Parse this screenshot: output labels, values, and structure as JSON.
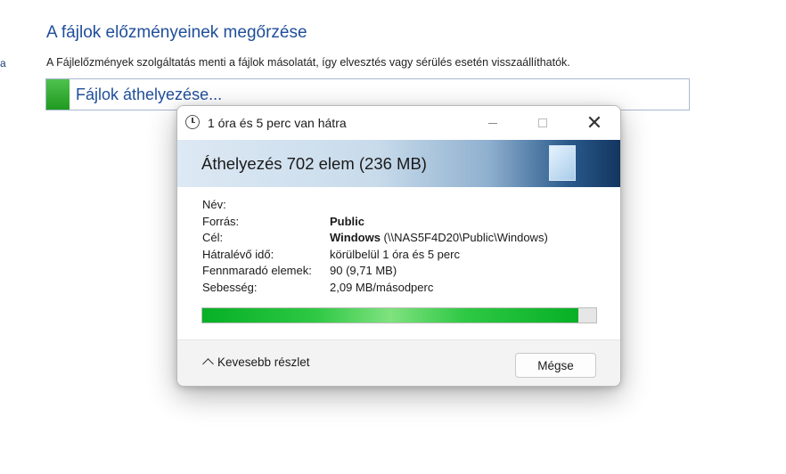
{
  "background": {
    "left_stub": "a",
    "title": "A fájlok előzményeinek megőrzése",
    "description": "A Fájlelőzmények szolgáltatás menti a fájlok másolatát, így elvesztés vagy sérülés esetén visszaállíthatók.",
    "progress_label": "Fájlok áthelyezése..."
  },
  "dialog": {
    "title": "1 óra és 5 perc van hátra",
    "header": "Áthelyezés 702 elem (236 MB)",
    "details": {
      "name_label": "Név:",
      "name_value": "",
      "source_label": "Forrás:",
      "source_value": "Public",
      "dest_label": "Cél:",
      "dest_bold": "Windows",
      "dest_path": " (\\\\NAS5F4D20\\Public\\Windows)",
      "remaining_time_label": "Hátralévő idő:",
      "remaining_time_value": "körülbelül 1 óra és 5 perc",
      "remaining_items_label": "Fennmaradó elemek:",
      "remaining_items_value": "90 (9,71 MB)",
      "speed_label": "Sebesség:",
      "speed_value": "2,09 MB/másodperc"
    },
    "progress_fraction": 0.955,
    "less_details_label": "Kevesebb részlet",
    "cancel_label": "Mégse"
  },
  "colors": {
    "accent_blue": "#1f4e9a",
    "progress_green": "#06b025"
  }
}
